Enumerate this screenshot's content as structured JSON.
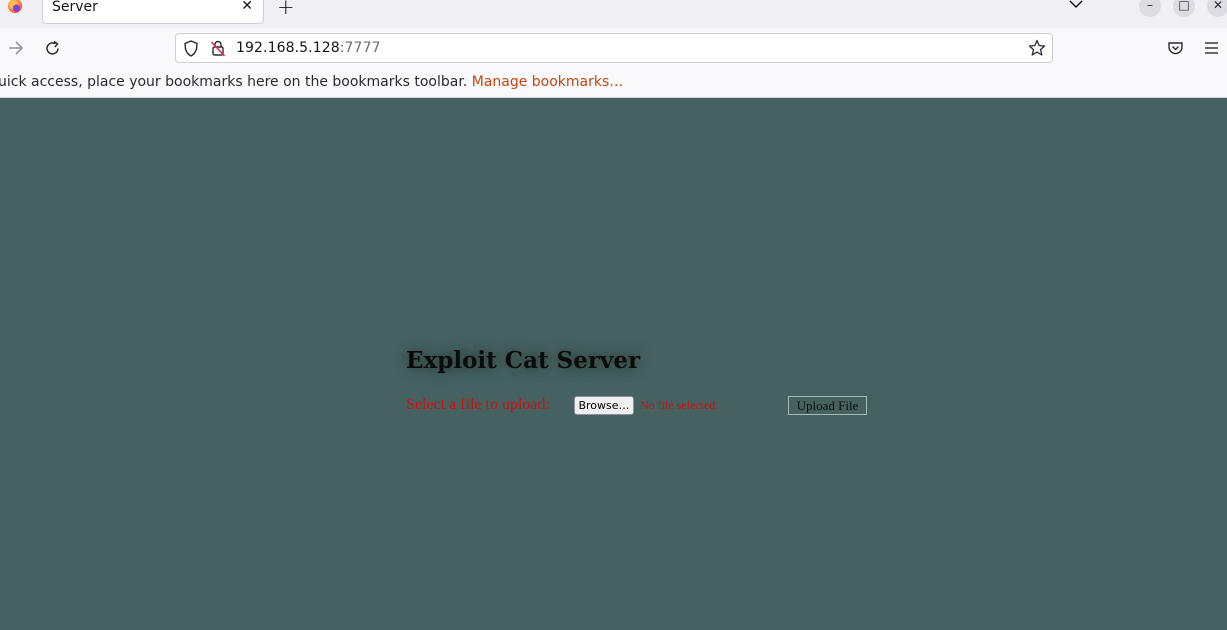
{
  "browser": {
    "tab_title": "Server",
    "tab_close_symbol": "✕",
    "new_tab_symbol": "+",
    "url_host": "192.168.5.128",
    "url_port": ":7777",
    "bookmarks_text": "uick access, place your bookmarks here on the bookmarks toolbar. ",
    "bookmarks_link": "Manage bookmarks…",
    "window_controls": {
      "minimize": "–",
      "maximize": "□",
      "close": "✕"
    }
  },
  "icons": {
    "firefox": "firefox-logo-icon",
    "forward": "arrow-right-icon",
    "reload": "reload-icon",
    "shield": "shield-icon",
    "insecure": "insecure-lock-icon",
    "bookmark_star": "star-icon",
    "pocket": "pocket-icon",
    "menu": "hamburger-menu-icon",
    "tab_list": "chevron-down-icon"
  },
  "page": {
    "heading": "Exploit Cat Server",
    "select_label": "Select a file to upload:",
    "browse_label": "Browse…",
    "no_file_text": "No file selected.",
    "upload_label": "Upload File"
  },
  "colors": {
    "page_background": "#456260",
    "label_red": "#cc1010",
    "bookmark_link": "#c4460f"
  }
}
